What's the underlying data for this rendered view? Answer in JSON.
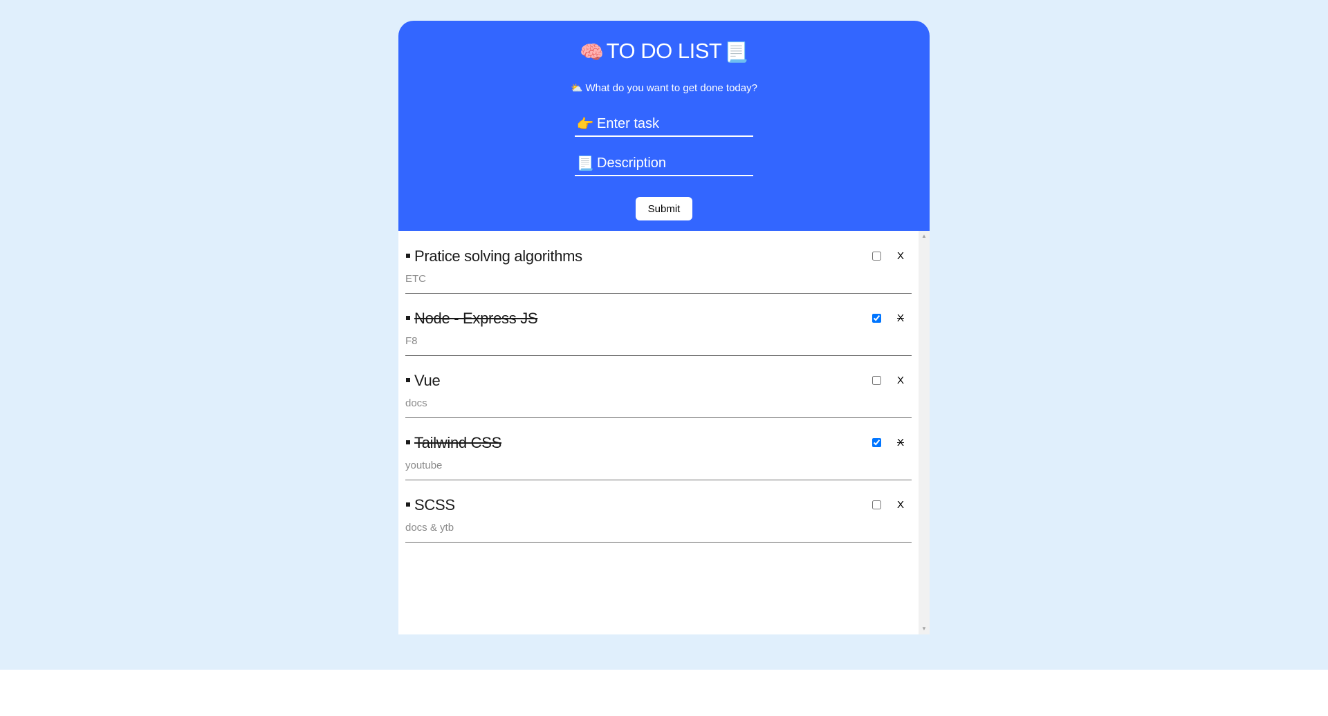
{
  "header": {
    "title": "TO DO LIST",
    "title_left_icon": "brain-icon",
    "title_right_icon": "scroll-icon",
    "subtitle": "What do you want to get done today?",
    "subtitle_icon": "cloud-icon",
    "accent_color": "#3366ff"
  },
  "form": {
    "task_icon": "pointing-hand-icon",
    "task_placeholder": "Enter task",
    "task_value": "",
    "desc_icon": "scroll-icon",
    "desc_placeholder": "Description",
    "desc_value": "",
    "submit_label": "Submit"
  },
  "todos": [
    {
      "title": "Pratice solving algorithms",
      "desc": "ETC",
      "done": false,
      "delete_label": "X"
    },
    {
      "title": "Node - Express JS",
      "desc": "F8",
      "done": true,
      "delete_label": "X"
    },
    {
      "title": "Vue",
      "desc": "docs",
      "done": false,
      "delete_label": "X"
    },
    {
      "title": "Tailwind CSS",
      "desc": "youtube",
      "done": true,
      "delete_label": "X"
    },
    {
      "title": "SCSS",
      "desc": "docs & ytb",
      "done": false,
      "delete_label": "X"
    }
  ],
  "colors": {
    "page_background": "#e0effc",
    "list_background": "#ffffff"
  }
}
